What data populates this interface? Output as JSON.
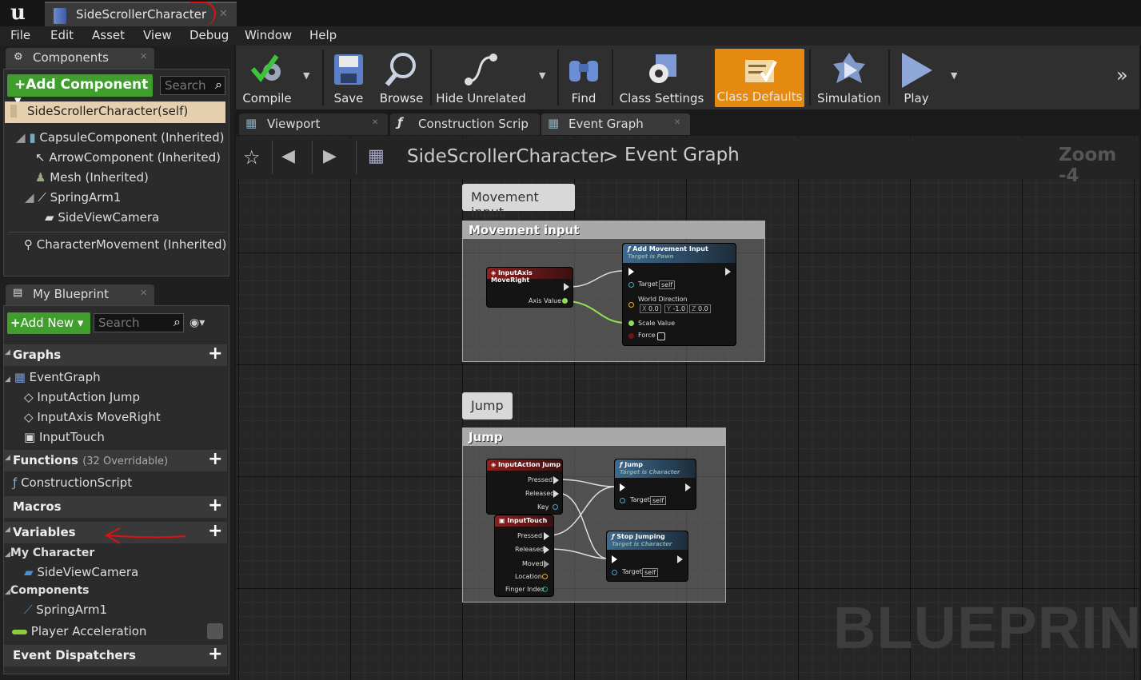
{
  "app": {
    "logo": "u",
    "document_tab": "SideScrollerCharacter"
  },
  "menu": [
    "File",
    "Edit",
    "Asset",
    "View",
    "Debug",
    "Window",
    "Help"
  ],
  "components_panel": {
    "title": "Components",
    "add_label": "+Add Component",
    "search_placeholder": "Search",
    "root": "SideScrollerCharacter(self)",
    "items": [
      "CapsuleComponent (Inherited)",
      "ArrowComponent (Inherited)",
      "Mesh (Inherited)",
      "SpringArm1",
      "SideViewCamera",
      "CharacterMovement (Inherited)"
    ]
  },
  "my_blueprint": {
    "title": "My Blueprint",
    "add_label": "Add New",
    "search_placeholder": "Search",
    "graphs": {
      "label": "Graphs",
      "eventgraph": "EventGraph",
      "items": [
        "InputAction Jump",
        "InputAxis MoveRight",
        "InputTouch"
      ]
    },
    "functions": {
      "label": "Functions",
      "count": "(32 Overridable)",
      "items": [
        "ConstructionScript"
      ]
    },
    "macros": "Macros",
    "variables": {
      "label": "Variables",
      "group1": "My Character",
      "g1_items": [
        "SideViewCamera"
      ],
      "group2": "Components",
      "g2_items": [
        "SpringArm1"
      ],
      "extra": "Player Acceleration"
    },
    "dispatchers": "Event Dispatchers"
  },
  "toolbar": [
    "Compile",
    "Save",
    "Browse",
    "Hide Unrelated",
    "Find",
    "Class Settings",
    "Class Defaults",
    "Simulation",
    "Play"
  ],
  "editor_tabs": [
    "Viewport",
    "Construction Scrip",
    "Event Graph"
  ],
  "breadcrumb": {
    "root": "SideScrollerCharacter",
    "sep": ">",
    "leaf": "Event Graph",
    "zoom": "Zoom -4"
  },
  "graph": {
    "comment1": {
      "bubble": "Movement input",
      "header": "Movement input"
    },
    "comment2": {
      "bubble": "Jump",
      "header": "Jump"
    },
    "n_moveright": {
      "title": "InputAxis MoveRight",
      "pin": "Axis Value"
    },
    "n_addmove": {
      "title": "Add Movement Input",
      "sub": "Target is Pawn",
      "target": "Target",
      "self": "self",
      "world": "World Direction",
      "x": "0.0",
      "y": "-1.0",
      "z": "0.0",
      "xl": "X",
      "yl": "Y",
      "zl": "Z",
      "scale": "Scale Value",
      "force": "Force"
    },
    "n_jump_in": {
      "title": "InputAction Jump",
      "pressed": "Pressed",
      "released": "Released",
      "key": "Key"
    },
    "n_touch": {
      "title": "InputTouch",
      "pressed": "Pressed",
      "released": "Released",
      "moved": "Moved",
      "location": "Location",
      "finger": "Finger Index"
    },
    "n_jump": {
      "title": "Jump",
      "sub": "Target is Character",
      "target": "Target",
      "self": "self"
    },
    "n_stop": {
      "title": "Stop Jumping",
      "sub": "Target is Character",
      "target": "Target",
      "self": "self"
    },
    "watermark": "BLUEPRINT"
  },
  "colors": {
    "accent_orange": "#e48a11",
    "add_green": "#3f9e2c",
    "annotation_red": "#dd1111"
  }
}
